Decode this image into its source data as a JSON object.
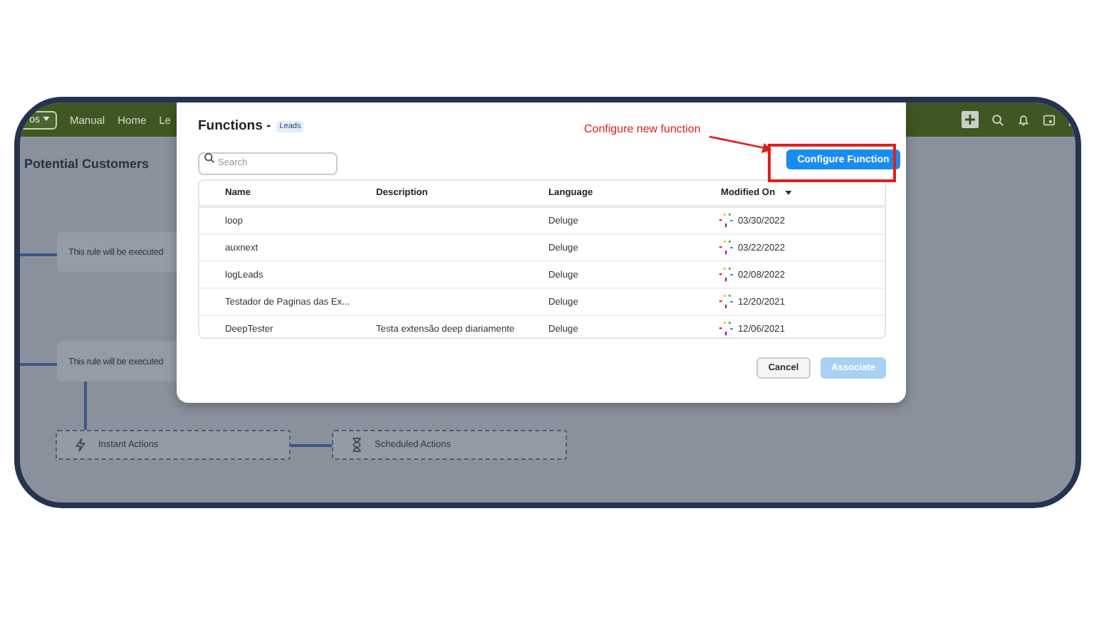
{
  "topbar": {
    "dropdown": "os",
    "links": [
      "Manual",
      "Home",
      "Le"
    ]
  },
  "page": {
    "title": "Potential Customers",
    "rule_nodes": [
      "This rule will be executed",
      "This rule will be executed"
    ],
    "actions": [
      {
        "kind": "instant",
        "label": "Instant Actions"
      },
      {
        "kind": "scheduled",
        "label": "Scheduled Actions"
      }
    ]
  },
  "modal": {
    "title": "Functions -",
    "module_badge": "Leads",
    "search": {
      "placeholder": "Search"
    },
    "configure_button": "Configure Function",
    "columns": [
      {
        "label": "Name",
        "sorted": false
      },
      {
        "label": "Description",
        "sorted": false
      },
      {
        "label": "Language",
        "sorted": false
      },
      {
        "label": "Modified On",
        "sorted": true
      }
    ],
    "rows": [
      {
        "name": "loop",
        "description": "",
        "language": "Deluge",
        "modified_on": "03/30/2022"
      },
      {
        "name": "auxnext",
        "description": "",
        "language": "Deluge",
        "modified_on": "03/22/2022"
      },
      {
        "name": "logLeads",
        "description": "",
        "language": "Deluge",
        "modified_on": "02/08/2022"
      },
      {
        "name": "Testador de Paginas das Ex...",
        "description": "",
        "language": "Deluge",
        "modified_on": "12/20/2021"
      },
      {
        "name": "DeepTester",
        "description": "Testa extensão deep diariamente",
        "language": "Deluge",
        "modified_on": "12/06/2021"
      }
    ],
    "cancel_button": "Cancel",
    "associate_button": {
      "label": "Associate",
      "disabled": true
    }
  },
  "annotation": {
    "text": "Configure new function"
  }
}
